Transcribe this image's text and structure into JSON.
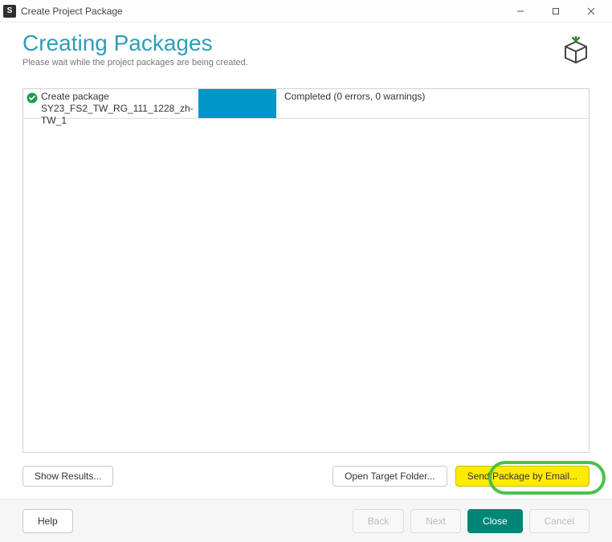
{
  "window": {
    "title": "Create Project Package",
    "icon_letter": "S"
  },
  "header": {
    "title": "Creating Packages",
    "subtitle": "Please wait while the project packages are being created."
  },
  "grid": {
    "rows": [
      {
        "action": "Create package",
        "file": "SY23_FS2_TW_RG_111_1228_zh-TW_1",
        "status": "Completed (0 errors, 0 warnings)"
      }
    ]
  },
  "actions": {
    "show_results": "Show Results...",
    "open_target": "Open Target Folder...",
    "send_email": "Send Package by Email..."
  },
  "footer": {
    "help": "Help",
    "back": "Back",
    "next": "Next",
    "close": "Close",
    "cancel": "Cancel"
  },
  "colors": {
    "accent": "#2f9eb8",
    "progress": "#0096c7",
    "highlight": "#ffeb00",
    "annotation": "#4ac24a",
    "primary_btn": "#008577"
  }
}
